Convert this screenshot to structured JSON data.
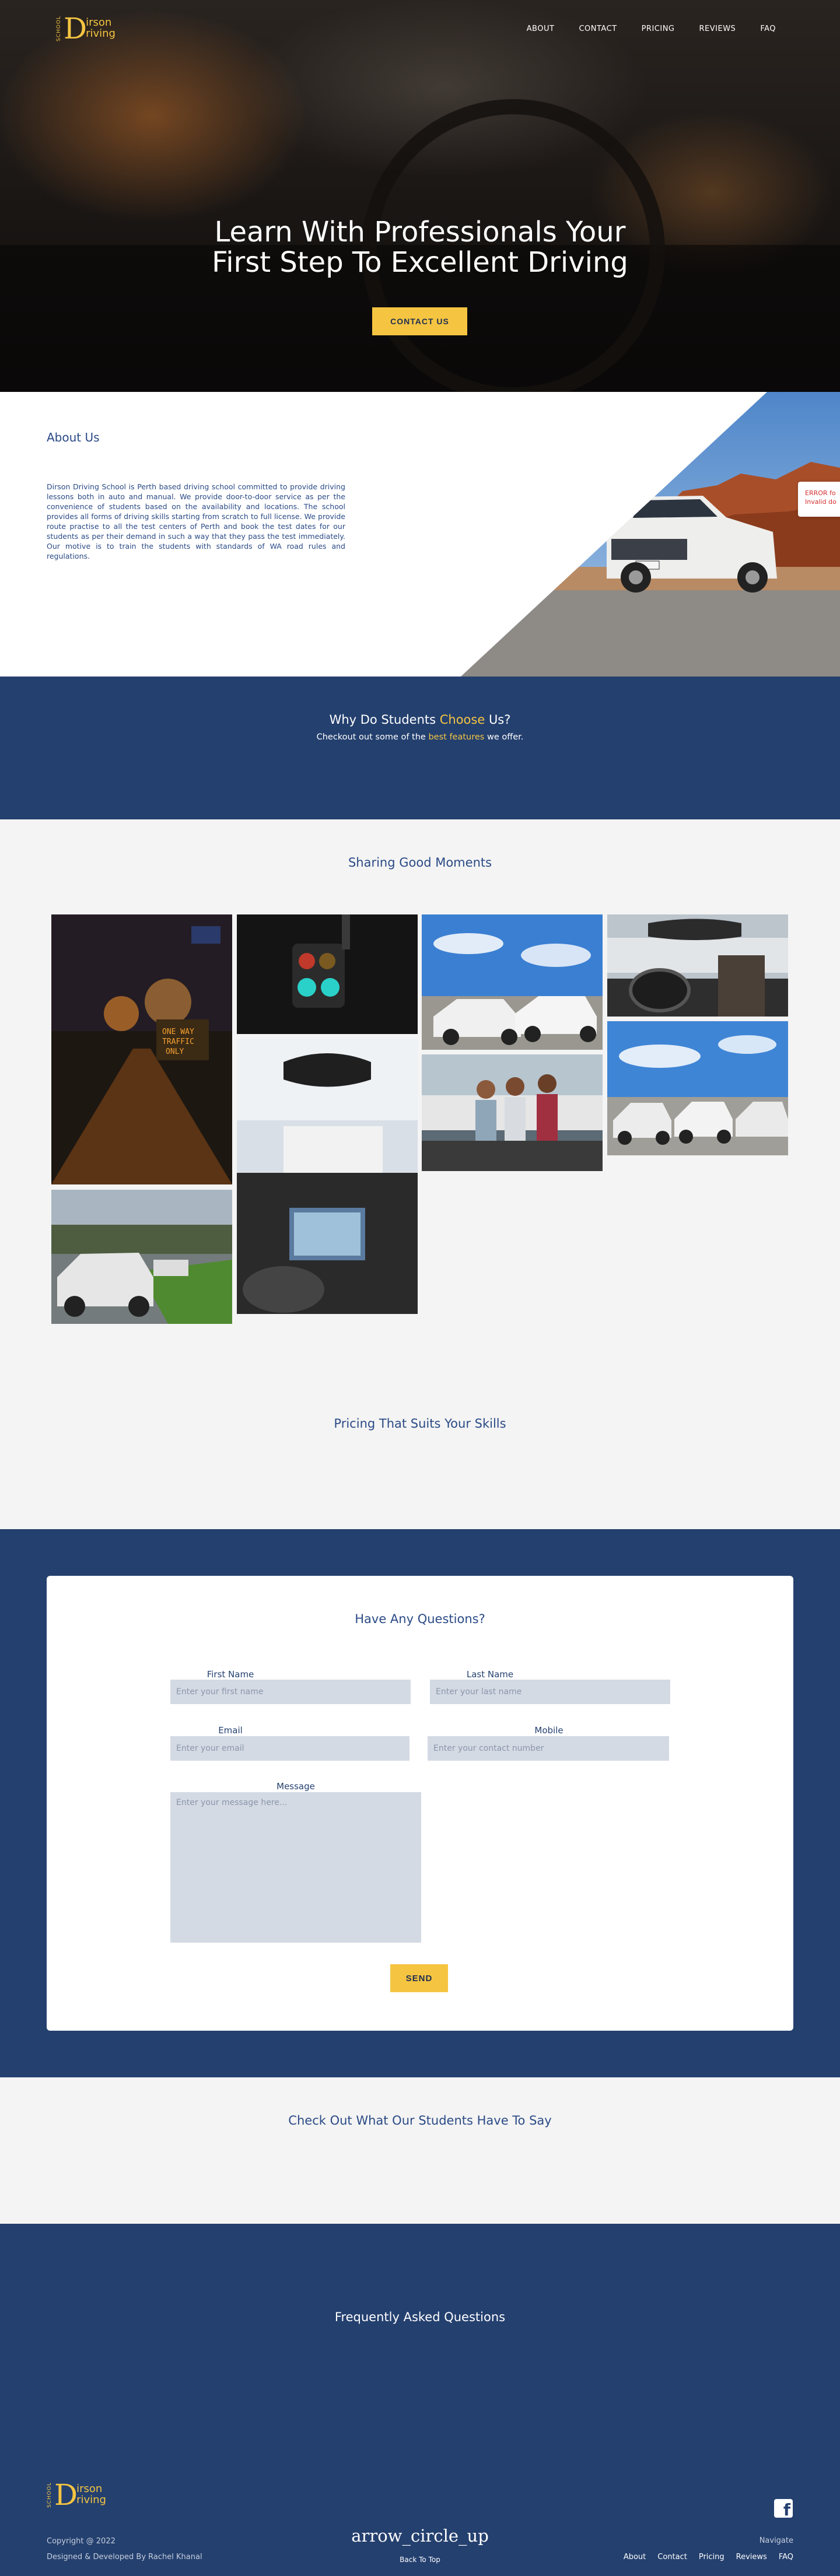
{
  "logo": {
    "school": "SCHOOL",
    "initial": "D",
    "line1": "irson",
    "line2": "riving"
  },
  "nav": [
    {
      "label": "ABOUT"
    },
    {
      "label": "CONTACT"
    },
    {
      "label": "PRICING"
    },
    {
      "label": "REVIEWS"
    },
    {
      "label": "FAQ"
    }
  ],
  "hero": {
    "title_line1": "Learn With Professionals Your",
    "title_line2": "First Step To Excellent Driving",
    "cta": "CONTACT US"
  },
  "about": {
    "heading": "About Us",
    "body": "Dirson Driving School is Perth based driving school committed to provide driving lessons both in auto and manual. We provide door-to-door service as per the convenience of students based on the availability and locations. The school provides all forms of driving skills starting from scratch to full license. We provide route practise to all the test centers of Perth and book the test dates for our students as per their demand in such a way that they pass the test immediately. Our motive is to train the students with standards of WA road rules and regulations.",
    "error_line1": "ERROR fo",
    "error_line2": "Invalid do"
  },
  "why": {
    "heading_pre": "Why Do Students ",
    "heading_hl": "Choose",
    "heading_post": " Us?",
    "sub_pre": "Checkout out some of the ",
    "sub_hl": "best features",
    "sub_post": " we offer."
  },
  "gallery": {
    "heading": "Sharing Good Moments",
    "sign_text": "ONE WAY TRAFFIC ONLY"
  },
  "pricing": {
    "heading": "Pricing That Suits Your Skills"
  },
  "contact": {
    "heading": "Have Any Questions?",
    "first_name_label": "First Name",
    "first_name_placeholder": "Enter your first name",
    "last_name_label": "Last Name",
    "last_name_placeholder": "Enter your last name",
    "email_label": "Email",
    "email_placeholder": "Enter your email",
    "mobile_label": "Mobile",
    "mobile_placeholder": "Enter your contact number",
    "message_label": "Message",
    "message_placeholder": "Enter your message here...",
    "send": "SEND"
  },
  "testimonials": {
    "heading": "Check Out What Our Students Have To Say"
  },
  "faq": {
    "heading": "Frequently Asked Questions"
  },
  "footer": {
    "copyright": "Copyright @ 2022",
    "credit": "Designed & Developed By Rachel Khanal",
    "arrow": "arrow_circle_up",
    "back_to_top": "Back To Top",
    "facebook_glyph": "f",
    "navigate": "Navigate",
    "links": [
      {
        "label": "About"
      },
      {
        "label": "Contact"
      },
      {
        "label": "Pricing"
      },
      {
        "label": "Reviews"
      },
      {
        "label": "FAQ"
      }
    ]
  },
  "colors": {
    "navy": "#24406f",
    "accent": "#f5c542",
    "light_bg": "#f4f4f4"
  }
}
